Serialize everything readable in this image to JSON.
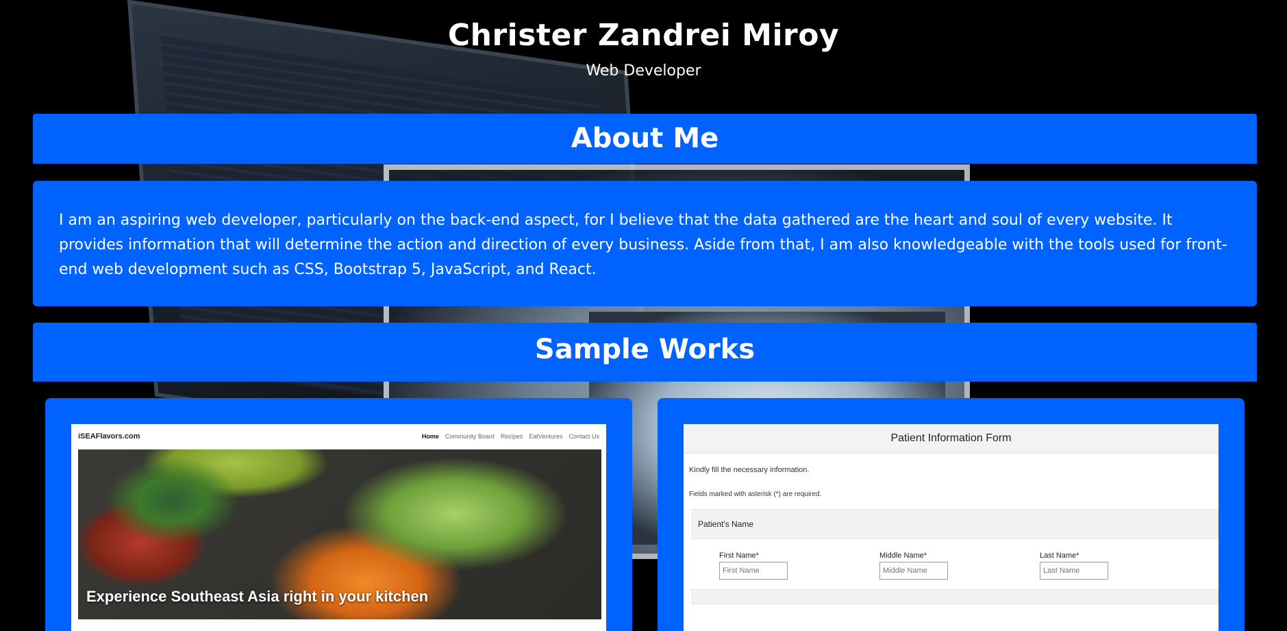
{
  "header": {
    "name": "Christer Zandrei Miroy",
    "role": "Web Developer"
  },
  "about": {
    "heading": "About Me",
    "text": "I am an aspiring web developer, particularly on the back-end aspect, for I believe that the data gathered are the heart and soul of every website. It provides information that will determine the action and direction of every business. Aside from that, I am also knowledgeable with the tools used for front-end web development such as CSS, Bootstrap 5, JavaScript, and React."
  },
  "works": {
    "heading": "Sample Works",
    "items": [
      {
        "brand": "iSEAFlavors.com",
        "nav": [
          "Home",
          "Community Board",
          "Recipes",
          "EatVentures",
          "Contact Us"
        ],
        "caption": "Experience Southeast Asia right in your kitchen"
      },
      {
        "title": "Patient Information Form",
        "note1": "Kindly fill the necessary information.",
        "note2": "Fields marked with asterisk (*) are required.",
        "section": "Patient's Name",
        "fields": [
          {
            "label": "First Name*",
            "placeholder": "First Name"
          },
          {
            "label": "Middle Name*",
            "placeholder": "Middle Name"
          },
          {
            "label": "Last Name*",
            "placeholder": "Last Name"
          }
        ]
      }
    ]
  },
  "colors": {
    "accent": "#0063ff",
    "background": "#000000",
    "text": "#ffffff"
  }
}
